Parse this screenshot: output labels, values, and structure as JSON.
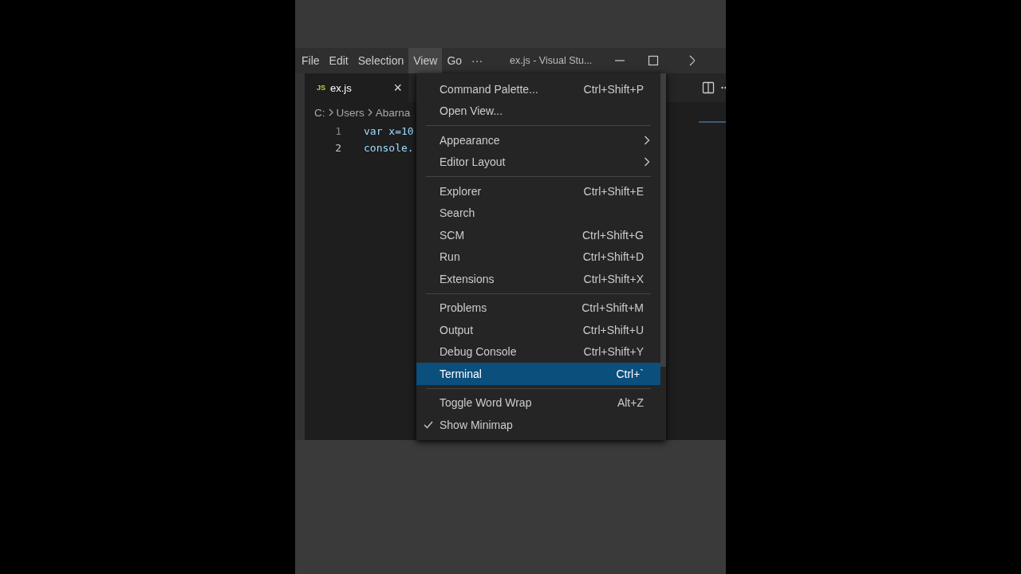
{
  "menubar": [
    {
      "label": "File",
      "selected": false
    },
    {
      "label": "Edit",
      "selected": false
    },
    {
      "label": "Selection",
      "selected": false
    },
    {
      "label": "View",
      "selected": true
    },
    {
      "label": "Go",
      "selected": false
    },
    {
      "label": "···",
      "selected": false
    }
  ],
  "window": {
    "title": "ex.js - Visual Stu..."
  },
  "tabs": [
    {
      "icon": "JS",
      "label": "ex.js",
      "close": "×",
      "selected": true
    }
  ],
  "breadcrumb": [
    "C:",
    "Users",
    "Abarna"
  ],
  "code": [
    {
      "number": "1",
      "text": "var x=10",
      "active": false
    },
    {
      "number": "2",
      "text": "console.",
      "active": true
    }
  ],
  "view_menu": [
    {
      "kind": "item",
      "label": "Command Palette...",
      "shortcut": "Ctrl+Shift+P",
      "selected": false,
      "checked": false
    },
    {
      "kind": "item",
      "label": "Open View...",
      "selected": false,
      "checked": false
    },
    {
      "kind": "separator"
    },
    {
      "kind": "submenu",
      "label": "Appearance",
      "selected": false,
      "checked": false
    },
    {
      "kind": "submenu",
      "label": "Editor Layout",
      "selected": false,
      "checked": false
    },
    {
      "kind": "separator"
    },
    {
      "kind": "item",
      "label": "Explorer",
      "shortcut": "Ctrl+Shift+E",
      "selected": false,
      "checked": false
    },
    {
      "kind": "item",
      "label": "Search",
      "selected": false,
      "checked": false
    },
    {
      "kind": "item",
      "label": "SCM",
      "shortcut": "Ctrl+Shift+G",
      "selected": false,
      "checked": false
    },
    {
      "kind": "item",
      "label": "Run",
      "shortcut": "Ctrl+Shift+D",
      "selected": false,
      "checked": false
    },
    {
      "kind": "item",
      "label": "Extensions",
      "shortcut": "Ctrl+Shift+X",
      "selected": false,
      "checked": false
    },
    {
      "kind": "separator"
    },
    {
      "kind": "item",
      "label": "Problems",
      "shortcut": "Ctrl+Shift+M",
      "selected": false,
      "checked": false
    },
    {
      "kind": "item",
      "label": "Output",
      "shortcut": "Ctrl+Shift+U",
      "selected": false,
      "checked": false
    },
    {
      "kind": "item",
      "label": "Debug Console",
      "shortcut": "Ctrl+Shift+Y",
      "selected": false,
      "checked": false
    },
    {
      "kind": "item",
      "label": "Terminal",
      "shortcut": "Ctrl+`",
      "selected": true,
      "checked": false
    },
    {
      "kind": "separator"
    },
    {
      "kind": "item",
      "label": "Toggle Word Wrap",
      "shortcut": "Alt+Z",
      "selected": false,
      "checked": false
    },
    {
      "kind": "item",
      "label": "Show Minimap",
      "selected": false,
      "checked": true
    }
  ]
}
